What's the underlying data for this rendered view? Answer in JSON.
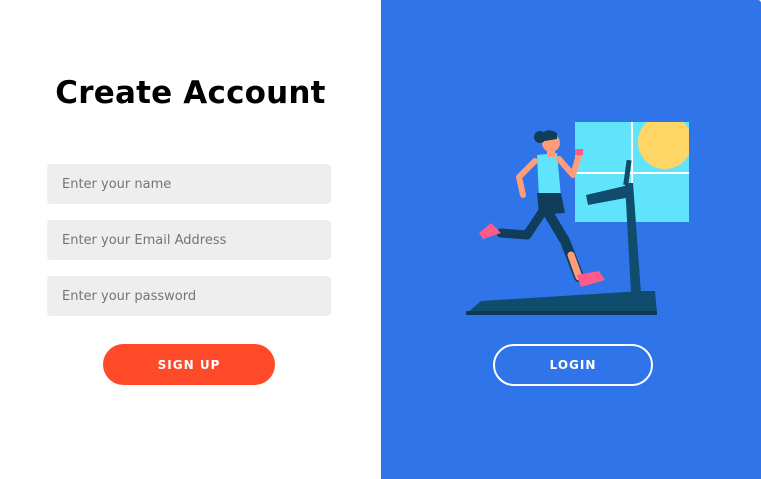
{
  "form": {
    "title": "Create Account",
    "name_placeholder": "Enter your name",
    "email_placeholder": "Enter your Email Address",
    "password_placeholder": "Enter your password",
    "signup_label": "SIGN UP"
  },
  "side": {
    "login_label": "LOGIN",
    "illustration": "treadmill-runner-illustration"
  },
  "colors": {
    "panel": "#2f74e9",
    "signup": "#ff4a2a",
    "field": "#eeeeee"
  }
}
